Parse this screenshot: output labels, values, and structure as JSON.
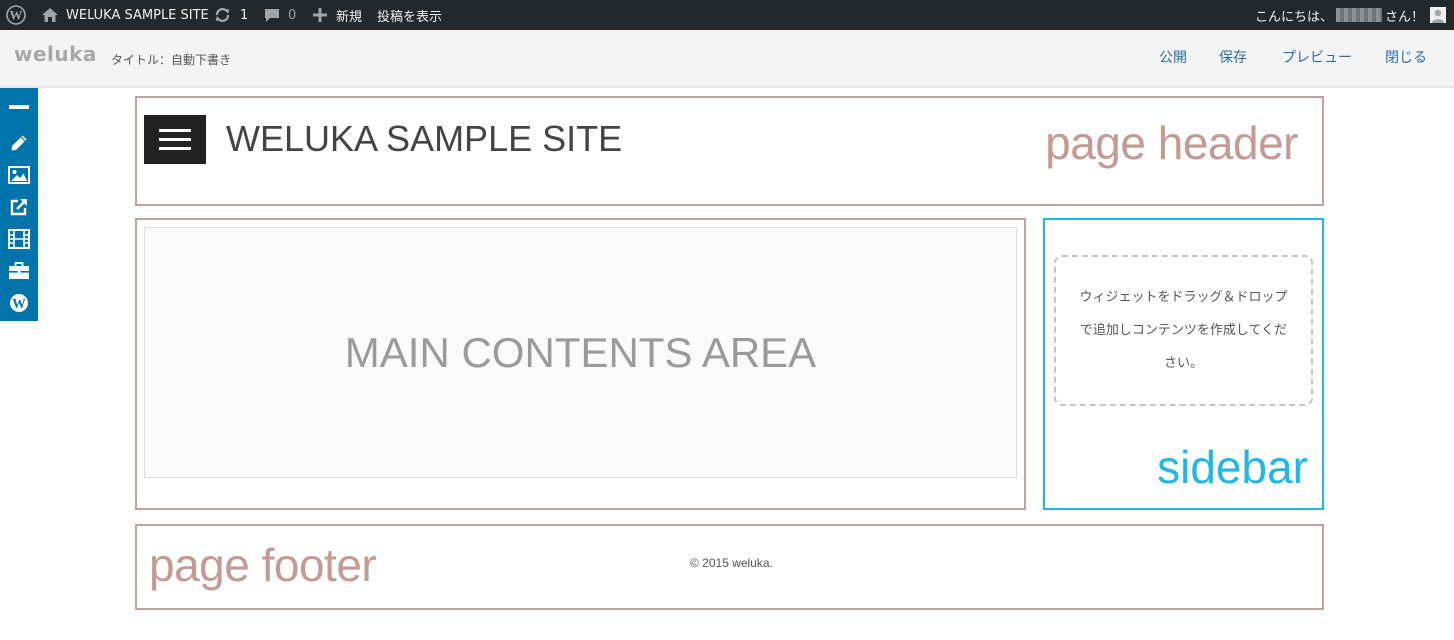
{
  "admin_bar": {
    "site_name": "WELUKA SAMPLE SITE",
    "updates_count": "1",
    "comments_count": "0",
    "new_label": "新規",
    "view_post_label": "投稿を表示",
    "greeting_prefix": "こんにちは、",
    "greeting_suffix": "さん！"
  },
  "editor_bar": {
    "logo": "weluka",
    "title_label": "タイトル：自動下書き",
    "actions": {
      "publish": "公開",
      "save": "保存",
      "preview": "プレビュー",
      "close": "閉じる"
    }
  },
  "toolbar": {
    "icons": [
      "minimize-icon",
      "pencil-icon",
      "image-icon",
      "external-link-icon",
      "film-icon",
      "toolbox-icon",
      "wordpress-icon"
    ]
  },
  "page_header": {
    "site_title": "WELUKA SAMPLE SITE",
    "region_label": "page header"
  },
  "main": {
    "region_text": "MAIN CONTENTS AREA"
  },
  "sidebar": {
    "widget_placeholder": "ウィジェットをドラッグ＆ドロップで追加しコンテンツを作成してください。",
    "region_label": "sidebar"
  },
  "page_footer": {
    "region_label": "page footer",
    "copyright": "© 2015 weluka."
  },
  "colors": {
    "admin_bar_bg": "#23282d",
    "toolbar_bg": "#0073aa",
    "header_footer_border": "#c0a39f",
    "sidebar_border": "#1fb7ea",
    "action_link": "#2a6fa5"
  }
}
